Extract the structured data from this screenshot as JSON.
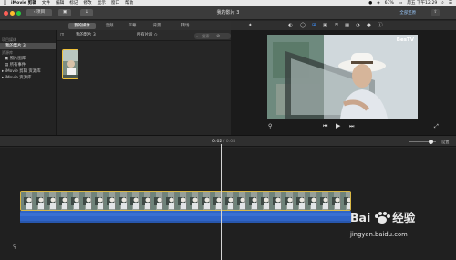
{
  "menubar": {
    "items": [
      "iMovie 剪辑",
      "文件",
      "编辑",
      "标记",
      "修改",
      "显示",
      "窗口",
      "帮助"
    ],
    "battery": "67%",
    "datetime": "周五 下午12:29"
  },
  "titlebar": {
    "back_label": "‹ 项目",
    "window_title": "我的影片 3",
    "reset_label": "全部还原"
  },
  "browser_tabs": [
    "我的媒体",
    "音频",
    "字幕",
    "背景",
    "转场"
  ],
  "sidebar": {
    "project_header": "项目媒体",
    "project_item": "我的影片 3",
    "library_header": "资源库",
    "items": [
      "照片图库",
      "所有事件",
      "iMovie 剪辑 资源库",
      "iMovie 资源库"
    ]
  },
  "browser": {
    "project_name": "我的影片 3",
    "filter": "所有片段 ◇",
    "search_placeholder": "搜索"
  },
  "viewer": {
    "watermark": "BesTV"
  },
  "timeline": {
    "current_time": "0:02",
    "separator": " / ",
    "total_time": "0:04",
    "settings_label": "设置"
  },
  "watermark": {
    "logo_left": "Bai",
    "logo_right": "经验",
    "url": "jingyan.baidu.com"
  },
  "colors": {
    "clip_border": "#d9b745",
    "audio": "#2f64c7",
    "selected_thumb_border": "#f0c23b"
  }
}
